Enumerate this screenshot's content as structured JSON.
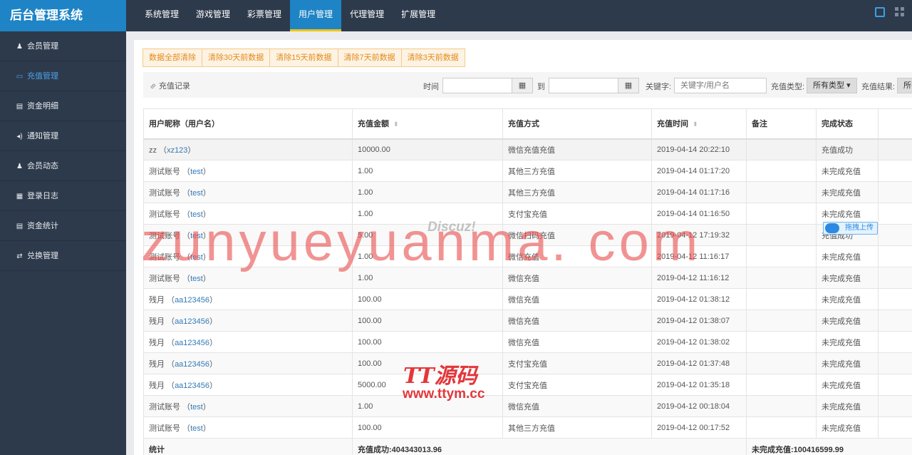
{
  "brand": "后台管理系统",
  "topnav": [
    {
      "label": "系统管理",
      "active": false
    },
    {
      "label": "游戏管理",
      "active": false
    },
    {
      "label": "彩票管理",
      "active": false
    },
    {
      "label": "用户管理",
      "active": true
    },
    {
      "label": "代理管理",
      "active": false
    },
    {
      "label": "扩展管理",
      "active": false
    }
  ],
  "sidebar": [
    {
      "label": "会员管理",
      "icon": "person-icon",
      "active": false
    },
    {
      "label": "充值管理",
      "icon": "card-icon",
      "active": true
    },
    {
      "label": "资金明细",
      "icon": "chart-icon",
      "active": false
    },
    {
      "label": "通知管理",
      "icon": "speaker-icon",
      "active": false
    },
    {
      "label": "会员动态",
      "icon": "person-icon",
      "active": false
    },
    {
      "label": "登录日志",
      "icon": "calendar-icon",
      "active": false
    },
    {
      "label": "资金统计",
      "icon": "chart-icon",
      "active": false
    },
    {
      "label": "兑换管理",
      "icon": "exchange-icon",
      "active": false
    }
  ],
  "clear_buttons": [
    "数据全部清除",
    "清除30天前数据",
    "清除15天前数据",
    "清除7天前数据",
    "清除3天前数据"
  ],
  "filter": {
    "title": "充值记录",
    "time_label": "时间",
    "to_label": "到",
    "keyword_label": "关键字:",
    "keyword_placeholder": "关键字/用户名",
    "type_label": "充值类型:",
    "type_value": "所有类型",
    "result_label": "充值结果:",
    "result_value": "所有"
  },
  "table": {
    "headers": [
      "用户昵称（用户名）",
      "充值金额",
      "充值方式",
      "充值时间",
      "备注",
      "完成状态"
    ],
    "rows": [
      {
        "nick": "zz",
        "user": "xz123",
        "amount": "10000.00",
        "method": "微信充值充值",
        "time": "2019-04-14 20:22:10",
        "note": "",
        "status": "充值成功",
        "ok": true
      },
      {
        "nick": "测试账号",
        "user": "test",
        "amount": "1.00",
        "method": "其他三方充值",
        "time": "2019-04-14 01:17:20",
        "note": "",
        "status": "未完成充值",
        "ok": false
      },
      {
        "nick": "测试账号",
        "user": "test",
        "amount": "1.00",
        "method": "其他三方充值",
        "time": "2019-04-14 01:17:16",
        "note": "",
        "status": "未完成充值",
        "ok": false
      },
      {
        "nick": "测试账号",
        "user": "test",
        "amount": "1.00",
        "method": "支付宝充值",
        "time": "2019-04-14 01:16:50",
        "note": "",
        "status": "未完成充值",
        "ok": false
      },
      {
        "nick": "测试账号",
        "user": "test",
        "amount": "5.00",
        "method": "微信扫码充值",
        "time": "2019-04-12 17:19:32",
        "note": "",
        "status": "充值成功",
        "ok": true
      },
      {
        "nick": "测试账号",
        "user": "test",
        "amount": "1.00",
        "method": "微信充值",
        "time": "2019-04-12 11:16:17",
        "note": "",
        "status": "未完成充值",
        "ok": false
      },
      {
        "nick": "测试账号",
        "user": "test",
        "amount": "1.00",
        "method": "微信充值",
        "time": "2019-04-12 11:16:12",
        "note": "",
        "status": "未完成充值",
        "ok": false
      },
      {
        "nick": "残月",
        "user": "aa123456",
        "amount": "100.00",
        "method": "微信充值",
        "time": "2019-04-12 01:38:12",
        "note": "",
        "status": "未完成充值",
        "ok": false
      },
      {
        "nick": "残月",
        "user": "aa123456",
        "amount": "100.00",
        "method": "微信充值",
        "time": "2019-04-12 01:38:07",
        "note": "",
        "status": "未完成充值",
        "ok": false
      },
      {
        "nick": "残月",
        "user": "aa123456",
        "amount": "100.00",
        "method": "微信充值",
        "time": "2019-04-12 01:38:02",
        "note": "",
        "status": "未完成充值",
        "ok": false
      },
      {
        "nick": "残月",
        "user": "aa123456",
        "amount": "100.00",
        "method": "支付宝充值",
        "time": "2019-04-12 01:37:48",
        "note": "",
        "status": "未完成充值",
        "ok": false
      },
      {
        "nick": "残月",
        "user": "aa123456",
        "amount": "5000.00",
        "method": "支付宝充值",
        "time": "2019-04-12 01:35:18",
        "note": "",
        "status": "未完成充值",
        "ok": false
      },
      {
        "nick": "测试账号",
        "user": "test",
        "amount": "1.00",
        "method": "微信充值",
        "time": "2019-04-12 00:18:04",
        "note": "",
        "status": "未完成充值",
        "ok": false
      },
      {
        "nick": "测试账号",
        "user": "test",
        "amount": "100.00",
        "method": "其他三方充值",
        "time": "2019-04-12 00:17:52",
        "note": "",
        "status": "未完成充值",
        "ok": false
      }
    ],
    "summary": {
      "label": "统计",
      "success": "充值成功:404343013.96",
      "pending": "未完成充值:100416599.99"
    }
  },
  "watermarks": {
    "site": "zunyueyuanma. com",
    "discuz": "Discuz!",
    "logo_text": "TT源码",
    "logo_url": "www.ttym.cc",
    "upload_tag": "拖拽上传"
  },
  "colors": {
    "topbar": "#2d3a4b",
    "brand_bg": "#1e84c6",
    "success": "#3c9b5c",
    "pending": "#e46a6a",
    "link": "#337ab7",
    "clear_btn": "#e48a1a"
  }
}
